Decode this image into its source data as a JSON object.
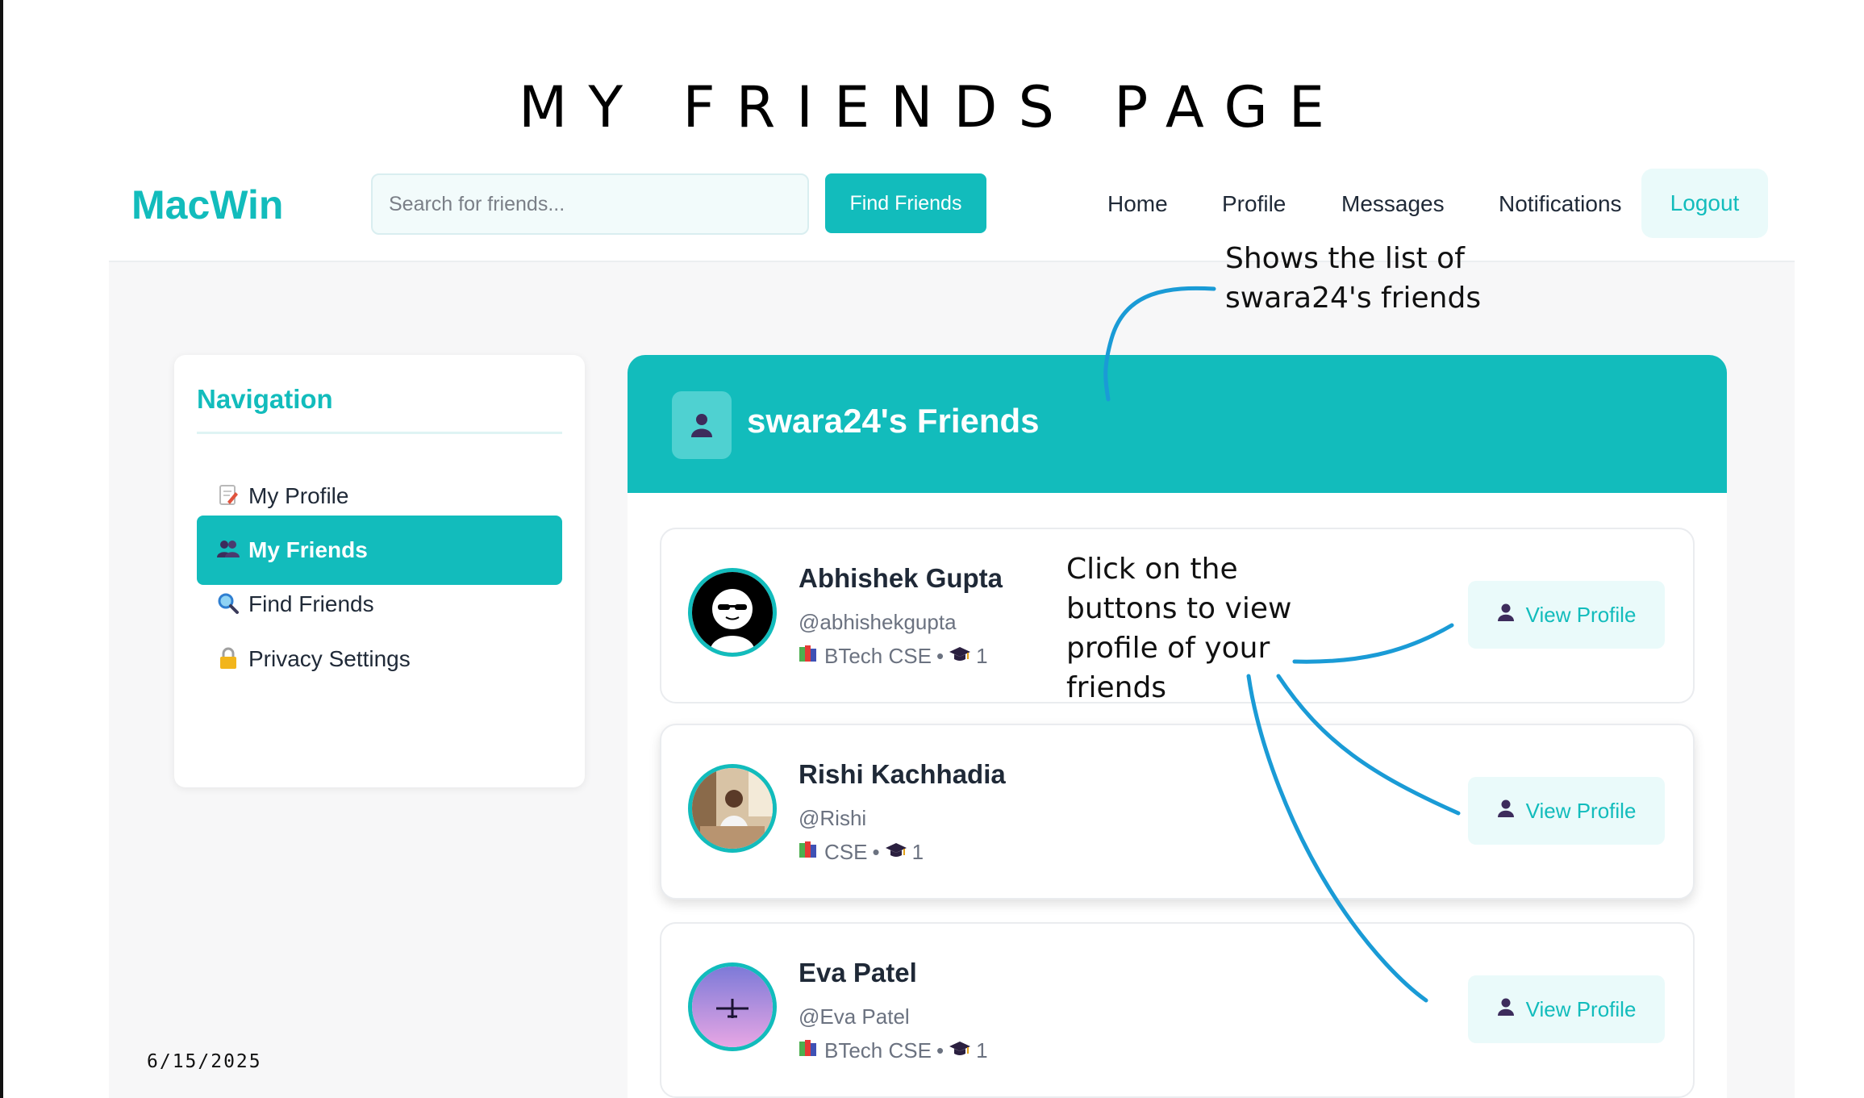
{
  "slide": {
    "title": "MY FRIENDS PAGE",
    "date": "6/15/2025"
  },
  "header": {
    "logo": "MacWin",
    "search_placeholder": "Search for friends...",
    "find_button": "Find Friends",
    "nav": [
      "Home",
      "Profile",
      "Messages",
      "Notifications"
    ],
    "logout": "Logout"
  },
  "sidebar": {
    "title": "Navigation",
    "items": [
      {
        "label": "My Profile",
        "icon": "memo-icon",
        "active": false
      },
      {
        "label": "My Friends",
        "icon": "people-icon",
        "active": true
      },
      {
        "label": "Find Friends",
        "icon": "magnifier-icon",
        "active": false
      },
      {
        "label": "Privacy Settings",
        "icon": "lock-icon",
        "active": false
      }
    ]
  },
  "panel": {
    "title": "swara24's Friends",
    "icon": "person-icon"
  },
  "friends": [
    {
      "name": "Abhishek Gupta",
      "username": "@abhishekgupta",
      "dept": "BTech CSE",
      "year": "1",
      "button": "View Profile"
    },
    {
      "name": "Rishi Kachhadia",
      "username": "@Rishi",
      "dept": "CSE",
      "year": "1",
      "button": "View Profile"
    },
    {
      "name": "Eva Patel",
      "username": "@Eva Patel",
      "dept": "BTech CSE",
      "year": "1",
      "button": "View Profile"
    }
  ],
  "annotations": {
    "top": [
      "Shows the list of",
      "swara24's friends"
    ],
    "middle": [
      "Click on the",
      "buttons to view",
      "profile of your",
      "friends"
    ]
  },
  "colors": {
    "accent": "#12bcbc",
    "accent_light": "#eafafa",
    "arrow": "#1a9bd6"
  }
}
